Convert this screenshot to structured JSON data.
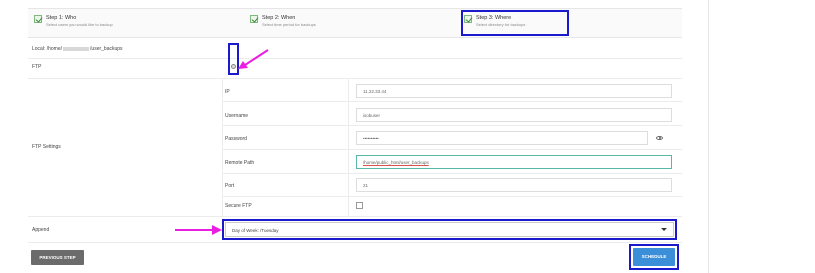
{
  "steps": [
    {
      "title": "Step 1: Who",
      "subtitle": "Select users you would like to backup"
    },
    {
      "title": "Step 2: When",
      "subtitle": "Select time period for backups"
    },
    {
      "title": "Step 3: Where",
      "subtitle": "Select directory for backups"
    }
  ],
  "local": {
    "label": "Local: /home/",
    "path_suffix": "/user_backups"
  },
  "ftp": {
    "label": "FTP"
  },
  "ftp_settings": {
    "label": "FTP Settings",
    "ip_label": "IP",
    "ip_value": "11.22.33.44",
    "username_label": "Username",
    "username_value": "isobuser",
    "password_label": "Password",
    "password_value": "••••••••••",
    "remote_path_label": "Remote Path",
    "remote_path_value": "/home/public_html/user_backups",
    "port_label": "Port",
    "port_value": "21",
    "secure_ftp_label": "Secure FTP"
  },
  "append": {
    "label": "Append",
    "selected": "Day of Week: /Tuesday"
  },
  "buttons": {
    "previous": "PREVIOUS STEP",
    "schedule": "SCHEDULE"
  },
  "colors": {
    "highlight": "#1a1acc",
    "arrow": "#e91ee0",
    "schedule_button": "#3b8fd9",
    "previous_button": "#6b6b6b"
  }
}
